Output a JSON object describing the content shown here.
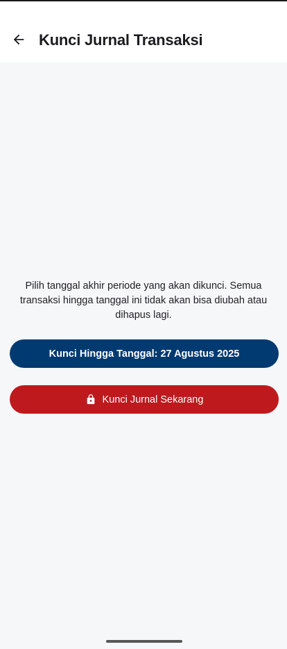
{
  "app_bar": {
    "title": "Kunci Jurnal Transaksi",
    "back_icon": "arrow-left-icon"
  },
  "description": "Pilih tanggal akhir periode yang akan dikunci. Semua transaksi hingga tanggal ini tidak akan bisa diubah atau dihapus lagi.",
  "date_button": {
    "label": "Kunci Hingga Tanggal: 27 Agustus 2025",
    "color": "#003a70"
  },
  "lock_button": {
    "label": "Kunci Jurnal Sekarang",
    "icon": "lock-icon",
    "color": "#be1a1e"
  },
  "colors": {
    "background": "#f6f7f9",
    "app_bar": "#ffffff",
    "text": "#1f1f23"
  }
}
